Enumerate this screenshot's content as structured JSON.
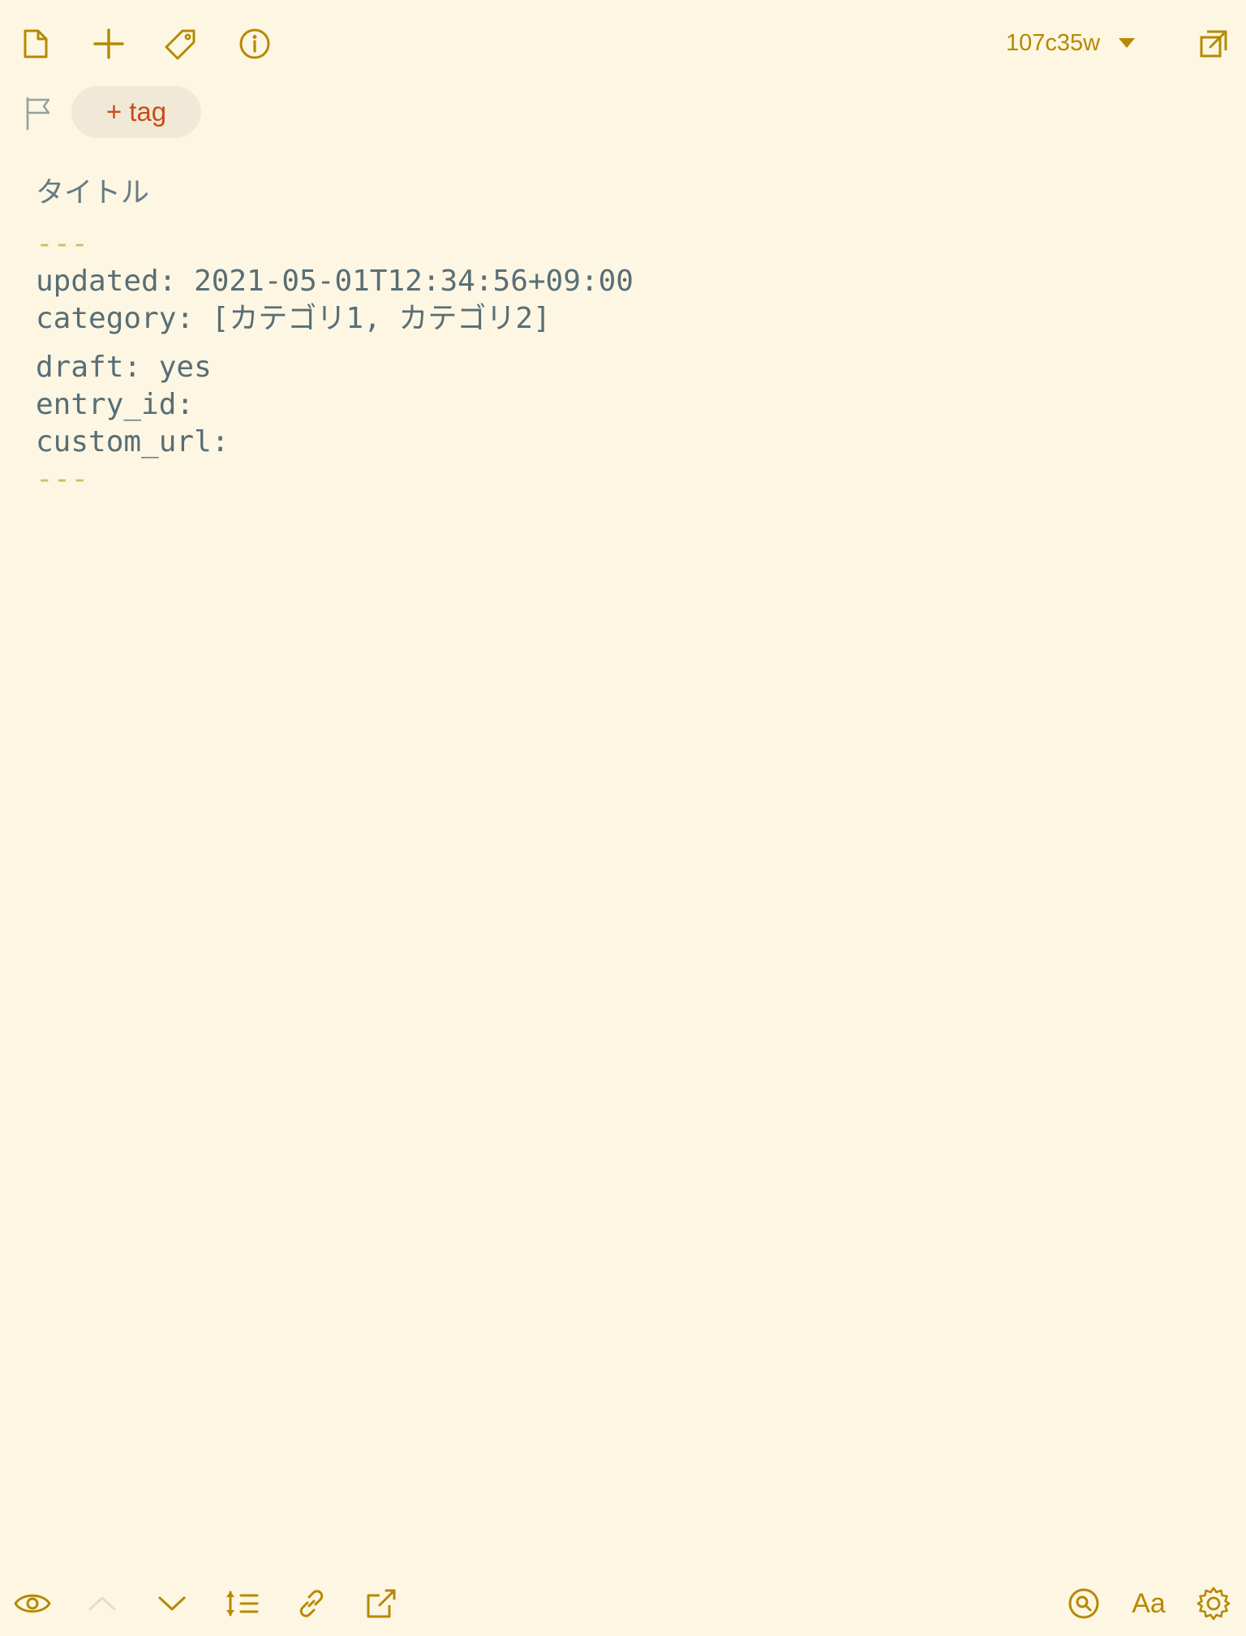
{
  "toolbar": {
    "note_id": "107c35w",
    "icons": {
      "new_note": "document-icon",
      "add": "plus-icon",
      "tag": "tag-icon",
      "info": "info-icon",
      "dropdown": "caret-down-icon",
      "expand": "expand-window-icon"
    },
    "accent_color": "#b58900"
  },
  "tags": {
    "add_label": "+ tag",
    "flag_icon": "flag-icon",
    "add_color": "#cb4b16"
  },
  "editor": {
    "title": "タイトル",
    "lines": {
      "frontmatter_open": "---",
      "updated": "updated: 2021-05-01T12:34:56+09:00",
      "category": "category: [カテゴリ1, カテゴリ2]",
      "draft": "draft: yes",
      "entry_id": "entry_id:",
      "custom_url": "custom_url:",
      "frontmatter_close": "---"
    }
  },
  "bottom_bar": {
    "icons": [
      "eye-icon",
      "chevron-up-icon",
      "chevron-down-icon",
      "line-spacing-icon",
      "link-icon",
      "share-icon",
      "search-icon",
      "font-icon",
      "gear-icon"
    ],
    "font_label": "Aa"
  },
  "colors": {
    "background": "#fdf6e3",
    "text": "#586e75",
    "muted": "#93a1a1"
  }
}
